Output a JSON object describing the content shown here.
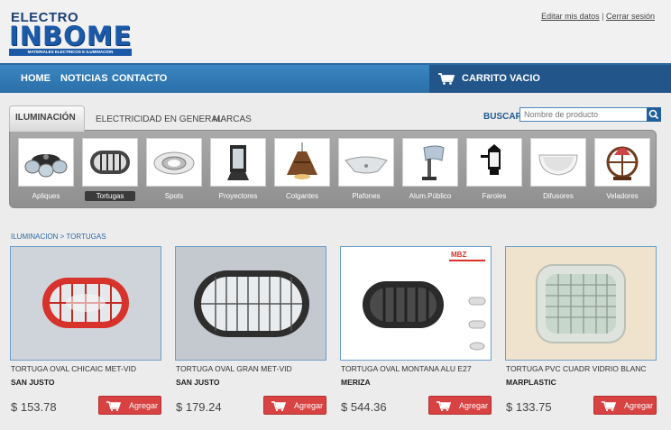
{
  "brand": {
    "top": "ELECTRO",
    "main": "INBOME",
    "tagline": "MATERIALES ELECTRICOS E ILUMINACION"
  },
  "user_links": {
    "edit": "Editar mis datos",
    "separator": "|",
    "logout": "Cerrar sesión"
  },
  "nav": {
    "items": [
      "HOME",
      "NOTICIAS",
      "CONTACTO"
    ],
    "cart": "CARRITO VACIO"
  },
  "tabs": [
    "ILUMINACIÓN",
    "ELECTRICIDAD EN GENERAL",
    "MARCAS"
  ],
  "search": {
    "label": "BUSCAR",
    "placeholder": "Nombre de producto"
  },
  "categories": [
    "Apliques",
    "Tortugas",
    "Spots",
    "Proyectores",
    "Colgantes",
    "Plafones",
    "Alum.Público",
    "Faroles",
    "Difusores",
    "Veladores"
  ],
  "breadcrumb": "ILUMINACION > TORTUGAS",
  "products": [
    {
      "name": "TORTUGA OVAL CHICAIC MET-VID",
      "brand": "SAN JUSTO",
      "price": "$ 153.78",
      "button": "Agregar"
    },
    {
      "name": "TORTUGA OVAL GRAN MET-VID",
      "brand": "SAN JUSTO",
      "price": "$ 179.24",
      "button": "Agregar"
    },
    {
      "name": "TORTUGA OVAL MONTANA ALU E27",
      "brand": "MERIZA",
      "price": "$ 544.36",
      "button": "Agregar"
    },
    {
      "name": "TORTUGA PVC CUADR VIDRIO BLANC",
      "brand": "MARPLASTIC",
      "price": "$ 133.75",
      "button": "Agregar"
    }
  ],
  "colors": {
    "nav_blue": "#2f78b5",
    "cart_blue": "#22568a",
    "add_red": "#d84242",
    "link_blue": "#2c6aa3"
  }
}
